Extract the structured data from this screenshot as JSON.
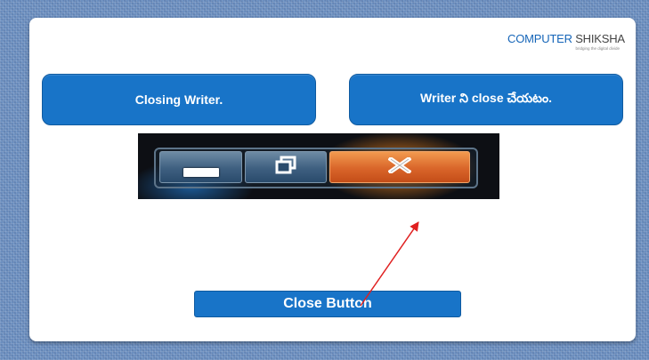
{
  "logo": {
    "main_a": "COMPUTER",
    "main_b": " SHIKSHA",
    "tagline": "bridging the digital divide"
  },
  "left_box": {
    "text": "Closing Writer."
  },
  "right_box": {
    "text": "Writer ని close చేయటం."
  },
  "titlebar": {
    "minimize_icon": "minimize-icon",
    "maximize_icon": "restore-icon",
    "close_icon": "close-icon",
    "close_glyph": "X"
  },
  "callout": {
    "label": "Close Button"
  },
  "colors": {
    "accent_blue": "#1874c8",
    "close_orange": "#d9652a",
    "arrow_red": "#e02020",
    "background": "#6b8fc0"
  }
}
